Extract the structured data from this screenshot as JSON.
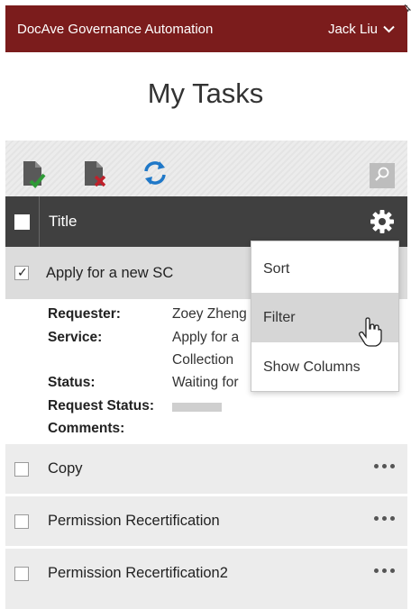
{
  "topbar": {
    "app_title": "DocAve Governance Automation",
    "user_name": "Jack Liu"
  },
  "page": {
    "title": "My Tasks"
  },
  "toolbar": {
    "icons": [
      "approve-document-icon",
      "reject-document-icon",
      "refresh-icon",
      "search-icon"
    ],
    "colors": {
      "approve": "#2e9a36",
      "reject": "#c0202a",
      "refresh": "#1f78c8"
    }
  },
  "table": {
    "header": {
      "title_label": "Title"
    },
    "selected": {
      "title": "Apply for a new SC",
      "details": {
        "requester_label": "Requester:",
        "requester_value": "Zoey Zheng",
        "service_label": "Service:",
        "service_value_line1": "Apply for a",
        "service_value_line2": "Collection",
        "status_label": "Status:",
        "status_value": "Waiting for",
        "request_status_label": "Request Status:",
        "comments_label": "Comments:"
      }
    },
    "rows": [
      {
        "title": "Copy"
      },
      {
        "title": "Permission Recertification"
      },
      {
        "title": "Permission Recertification2"
      }
    ]
  },
  "column_menu": {
    "items": [
      "Sort",
      "Filter",
      "Show Columns"
    ],
    "active": "Filter"
  },
  "colors": {
    "brand": "#7b1c1c",
    "header_bg": "#404040"
  }
}
